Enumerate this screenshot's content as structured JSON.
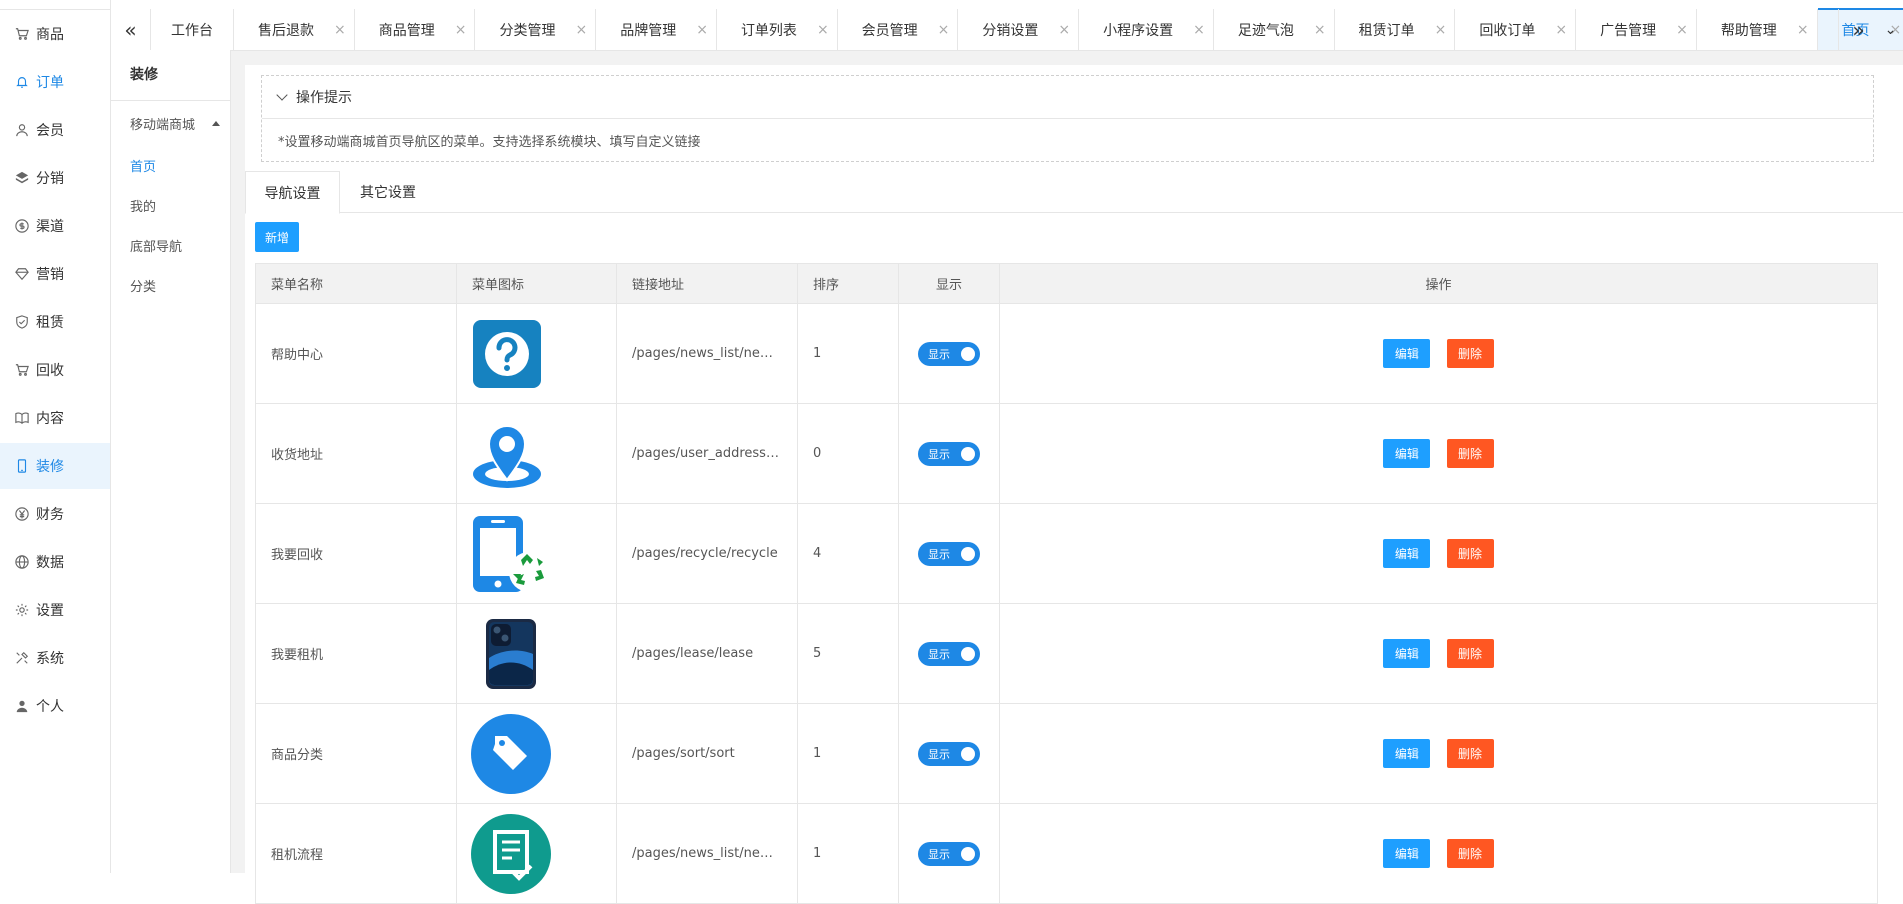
{
  "sidebar": {
    "items": [
      {
        "label": "商品",
        "icon": "cart-icon"
      },
      {
        "label": "订单",
        "icon": "bell-icon"
      },
      {
        "label": "会员",
        "icon": "user-icon"
      },
      {
        "label": "分销",
        "icon": "layers-icon"
      },
      {
        "label": "渠道",
        "icon": "dollar-circle-icon"
      },
      {
        "label": "营销",
        "icon": "diamond-icon"
      },
      {
        "label": "租赁",
        "icon": "shield-check-icon"
      },
      {
        "label": "回收",
        "icon": "cart-icon"
      },
      {
        "label": "内容",
        "icon": "book-icon"
      },
      {
        "label": "装修",
        "icon": "phone-icon"
      },
      {
        "label": "财务",
        "icon": "yen-circle-icon"
      },
      {
        "label": "数据",
        "icon": "globe-icon"
      },
      {
        "label": "设置",
        "icon": "gear-icon"
      },
      {
        "label": "系统",
        "icon": "tools-icon"
      },
      {
        "label": "个人",
        "icon": "person-icon"
      }
    ]
  },
  "subnav": {
    "title": "装修",
    "group": "移动端商城",
    "links": [
      "首页",
      "我的",
      "底部导航",
      "分类"
    ]
  },
  "tabs": [
    {
      "label": "工作台"
    },
    {
      "label": "售后退款"
    },
    {
      "label": "商品管理"
    },
    {
      "label": "分类管理"
    },
    {
      "label": "品牌管理"
    },
    {
      "label": "订单列表"
    },
    {
      "label": "会员管理"
    },
    {
      "label": "分销设置"
    },
    {
      "label": "小程序设置"
    },
    {
      "label": "足迹气泡"
    },
    {
      "label": "租赁订单"
    },
    {
      "label": "回收订单"
    },
    {
      "label": "广告管理"
    },
    {
      "label": "帮助管理"
    },
    {
      "label": "首页"
    }
  ],
  "tips": {
    "title": "操作提示",
    "text": "*设置移动端商城首页导航区的菜单。支持选择系统模块、填写自定义链接"
  },
  "content_tabs": [
    "导航设置",
    "其它设置"
  ],
  "add_button": "新增",
  "table": {
    "headers": [
      "菜单名称",
      "菜单图标",
      "链接地址",
      "排序",
      "显示",
      "操作"
    ],
    "toggle_label": "显示",
    "edit_label": "编辑",
    "delete_label": "删除",
    "rows": [
      {
        "name": "帮助中心",
        "icon": "help-question-icon",
        "url": "/pages/news_list/news_list",
        "sort": "1"
      },
      {
        "name": "收货地址",
        "icon": "location-pin-icon",
        "url": "/pages/user_address/user_address",
        "sort": "0"
      },
      {
        "name": "我要回收",
        "icon": "phone-recycle-icon",
        "url": "/pages/recycle/recycle",
        "sort": "4"
      },
      {
        "name": "我要租机",
        "icon": "smartphone-icon",
        "url": "/pages/lease/lease",
        "sort": "5"
      },
      {
        "name": "商品分类",
        "icon": "tag-icon",
        "url": "/pages/sort/sort",
        "sort": "1"
      },
      {
        "name": "租机流程",
        "icon": "document-check-icon",
        "url": "/pages/news_list/news_list",
        "sort": "1"
      }
    ]
  }
}
